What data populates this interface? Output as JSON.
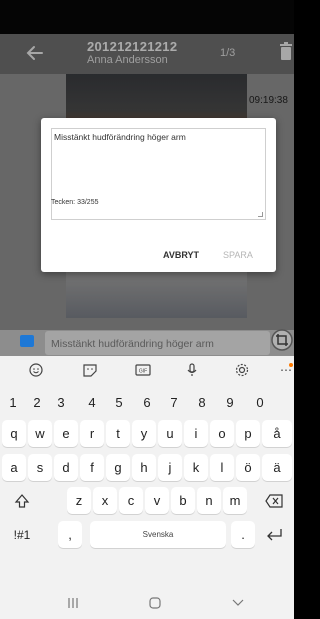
{
  "header": {
    "title": "201212121212",
    "subtitle": "Anna Andersson",
    "counter": "1/3"
  },
  "photo": {
    "timestamp": "09:19:38"
  },
  "caption": {
    "text": "Misstänkt hudförändring höger arm"
  },
  "dialog": {
    "text": "Misstänkt hudförändring höger arm",
    "char_count": "Tecken: 33/255",
    "cancel_label": "AVBRYT",
    "save_label": "SPARA"
  },
  "keyboard": {
    "toolbar_icons": [
      "emoji-icon",
      "sticker-icon",
      "gif-icon",
      "mic-icon",
      "settings-icon",
      "more-icon"
    ],
    "gif_label": "GIF",
    "numbers": [
      "1",
      "2",
      "3",
      "4",
      "5",
      "6",
      "7",
      "8",
      "9",
      "0"
    ],
    "row1": [
      "q",
      "w",
      "e",
      "r",
      "t",
      "y",
      "u",
      "i",
      "o",
      "p",
      "å"
    ],
    "row2": [
      "a",
      "s",
      "d",
      "f",
      "g",
      "h",
      "j",
      "k",
      "l",
      "ö",
      "ä"
    ],
    "row3": [
      "z",
      "x",
      "c",
      "v",
      "b",
      "n",
      "m"
    ],
    "symbols_label": "!#1",
    "comma_label": ",",
    "space_label": "Svenska",
    "period_label": "."
  },
  "colors": {
    "accent": "#1e78d6",
    "header_bg": "#6e6e6e"
  }
}
